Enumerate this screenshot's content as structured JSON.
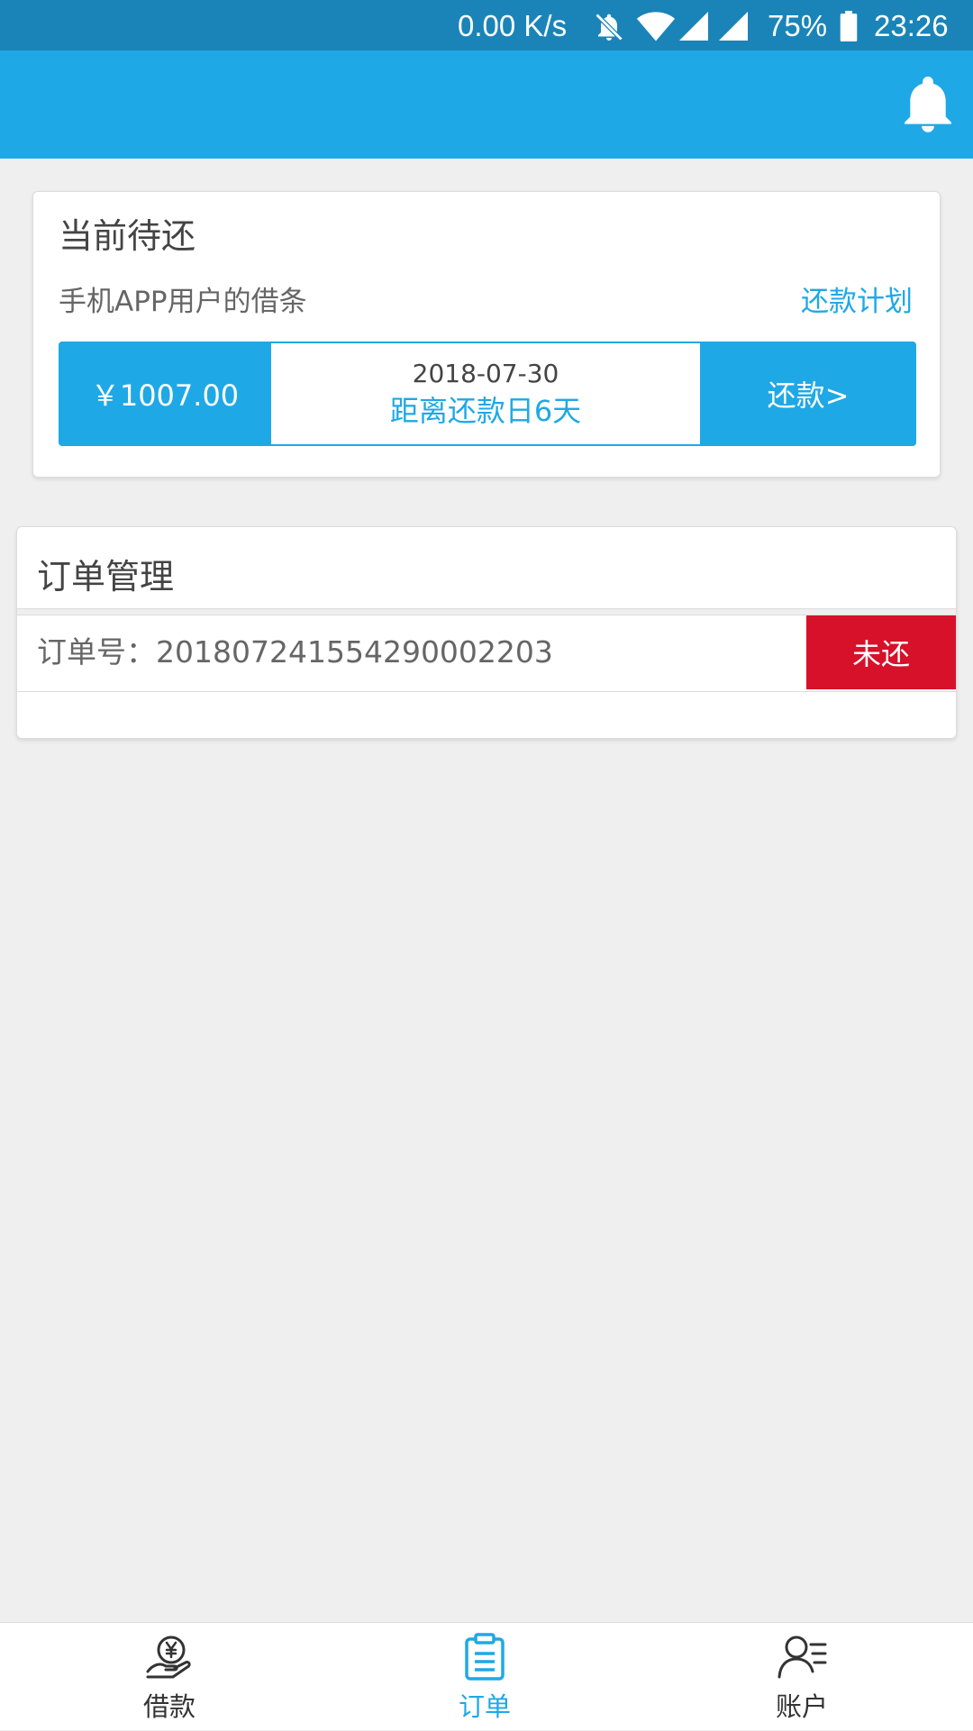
{
  "status_bar": {
    "network_speed": "0.00 K/s",
    "battery_percent": "75%",
    "time": "23:26",
    "icons": [
      "notifications-off-icon",
      "wifi-icon",
      "signal-icon",
      "signal-icon",
      "battery-icon"
    ]
  },
  "header": {
    "icon": "bell-icon"
  },
  "pending": {
    "title": "当前待还",
    "subtitle": "手机APP用户的借条",
    "plan_link": "还款计划",
    "amount": "￥1007.00",
    "due_date": "2018-07-30",
    "countdown": "距离还款日6天",
    "repay_label": "还款>"
  },
  "orders": {
    "title": "订单管理",
    "items": [
      {
        "number": "订单号：201807241554290002203",
        "status": "未还"
      }
    ]
  },
  "bottom_nav": {
    "items": [
      {
        "label": "借款",
        "icon": "loan-hand-icon",
        "active": false
      },
      {
        "label": "订单",
        "icon": "clipboard-icon",
        "active": true
      },
      {
        "label": "账户",
        "icon": "user-list-icon",
        "active": false
      }
    ]
  },
  "colors": {
    "status_bar": "#1a84b8",
    "primary": "#1fa8e6",
    "unpaid_badge": "#d7112a",
    "background": "#efefef"
  }
}
